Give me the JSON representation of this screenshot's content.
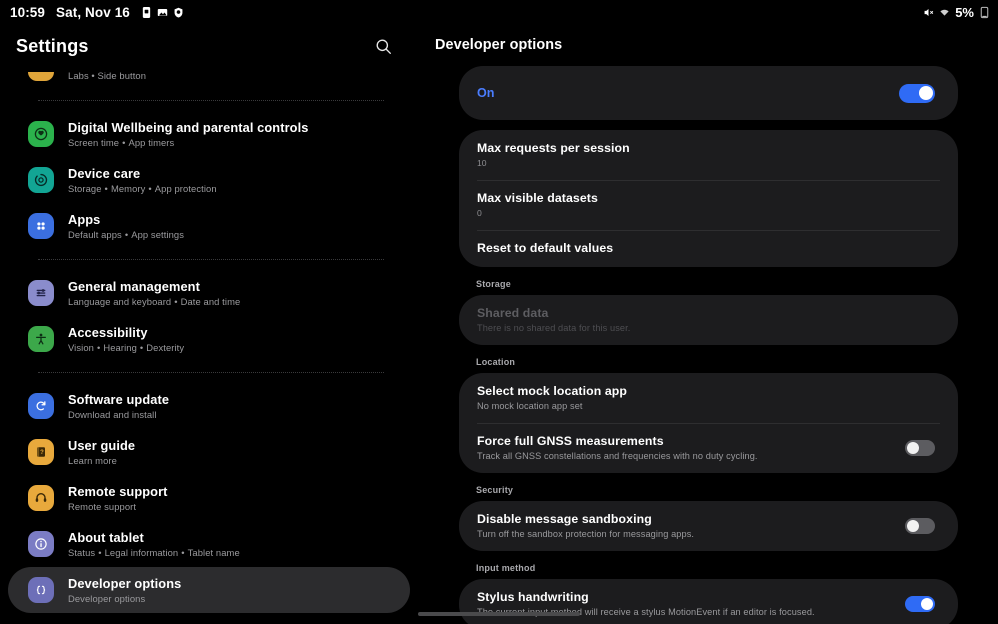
{
  "status_bar": {
    "time": "10:59",
    "date": "Sat, Nov 16",
    "left_icons": [
      "sim-card-icon",
      "photo-icon",
      "shield-icon"
    ],
    "right_icons": [
      "mute-icon",
      "wifi-icon"
    ],
    "battery_percent": "5%"
  },
  "sidebar": {
    "title": "Settings",
    "search_icon": "search-icon",
    "items": [
      {
        "title": "",
        "subtitle": "Labs  •  Side button",
        "icon": "advanced-features-icon",
        "icon_color": "#e0a53a",
        "clipped": true,
        "selected": false
      },
      {
        "divider_after": true
      },
      {
        "title": "Digital Wellbeing and parental controls",
        "subtitle_parts": [
          "Screen time",
          "App timers"
        ],
        "icon": "wellbeing-icon",
        "icon_color": "#2bb24c",
        "selected": false
      },
      {
        "title": "Device care",
        "subtitle_parts": [
          "Storage",
          "Memory",
          "App protection"
        ],
        "icon": "device-care-icon",
        "icon_color": "#12a594",
        "selected": false
      },
      {
        "title": "Apps",
        "subtitle_parts": [
          "Default apps",
          "App settings"
        ],
        "icon": "apps-grid-icon",
        "icon_color": "#3b6fe0",
        "selected": false
      },
      {
        "divider_after": true
      },
      {
        "title": "General management",
        "subtitle_parts": [
          "Language and keyboard",
          "Date and time"
        ],
        "icon": "sliders-icon",
        "icon_color": "#8a8ccc",
        "selected": false
      },
      {
        "title": "Accessibility",
        "subtitle_parts": [
          "Vision",
          "Hearing",
          "Dexterity"
        ],
        "icon": "accessibility-icon",
        "icon_color": "#3ca84a",
        "selected": false
      },
      {
        "divider_after": true
      },
      {
        "title": "Software update",
        "subtitle_parts": [
          "Download and install"
        ],
        "icon": "software-update-icon",
        "icon_color": "#3b6fe0",
        "selected": false
      },
      {
        "title": "User guide",
        "subtitle_parts": [
          "Learn more"
        ],
        "icon": "user-guide-icon",
        "icon_color": "#e8a93c",
        "selected": false
      },
      {
        "title": "Remote support",
        "subtitle_parts": [
          "Remote support"
        ],
        "icon": "headset-icon",
        "icon_color": "#e8a93c",
        "selected": false
      },
      {
        "title": "About tablet",
        "subtitle_parts": [
          "Status",
          "Legal information",
          "Tablet name"
        ],
        "icon": "info-icon",
        "icon_color": "#7b7cc4",
        "selected": false
      },
      {
        "title": "Developer options",
        "subtitle_parts": [
          "Developer options"
        ],
        "icon": "code-braces-icon",
        "icon_color": "#6d6fb8",
        "selected": true
      }
    ]
  },
  "detail": {
    "title": "Developer options",
    "master_switch": {
      "label": "On",
      "state": "on",
      "label_color": "#4a7dff"
    },
    "groups": [
      {
        "section": null,
        "items": [
          {
            "title": "Max requests per session",
            "value": "10",
            "type": "value"
          },
          {
            "title": "Max visible datasets",
            "value": "0",
            "type": "value"
          },
          {
            "title": "Reset to default values",
            "type": "action"
          }
        ]
      },
      {
        "section": "Storage",
        "items": [
          {
            "title": "Shared data",
            "subtitle": "There is no shared data for this user.",
            "type": "disabled"
          }
        ]
      },
      {
        "section": "Location",
        "items": [
          {
            "title": "Select mock location app",
            "subtitle": "No mock location app set",
            "type": "value"
          },
          {
            "title": "Force full GNSS measurements",
            "subtitle": "Track all GNSS constellations and frequencies with no duty cycling.",
            "type": "switch",
            "state": "off"
          }
        ]
      },
      {
        "section": "Security",
        "items": [
          {
            "title": "Disable message sandboxing",
            "subtitle": "Turn off the sandbox protection for messaging apps.",
            "type": "switch",
            "state": "off"
          }
        ]
      },
      {
        "section": "Input method",
        "items": [
          {
            "title": "Stylus handwriting",
            "subtitle": "The current input method will receive a stylus MotionEvent if an editor is focused.",
            "type": "switch",
            "state": "on"
          }
        ]
      }
    ]
  },
  "navigation": {
    "home_bar": "gesture-home-bar"
  }
}
